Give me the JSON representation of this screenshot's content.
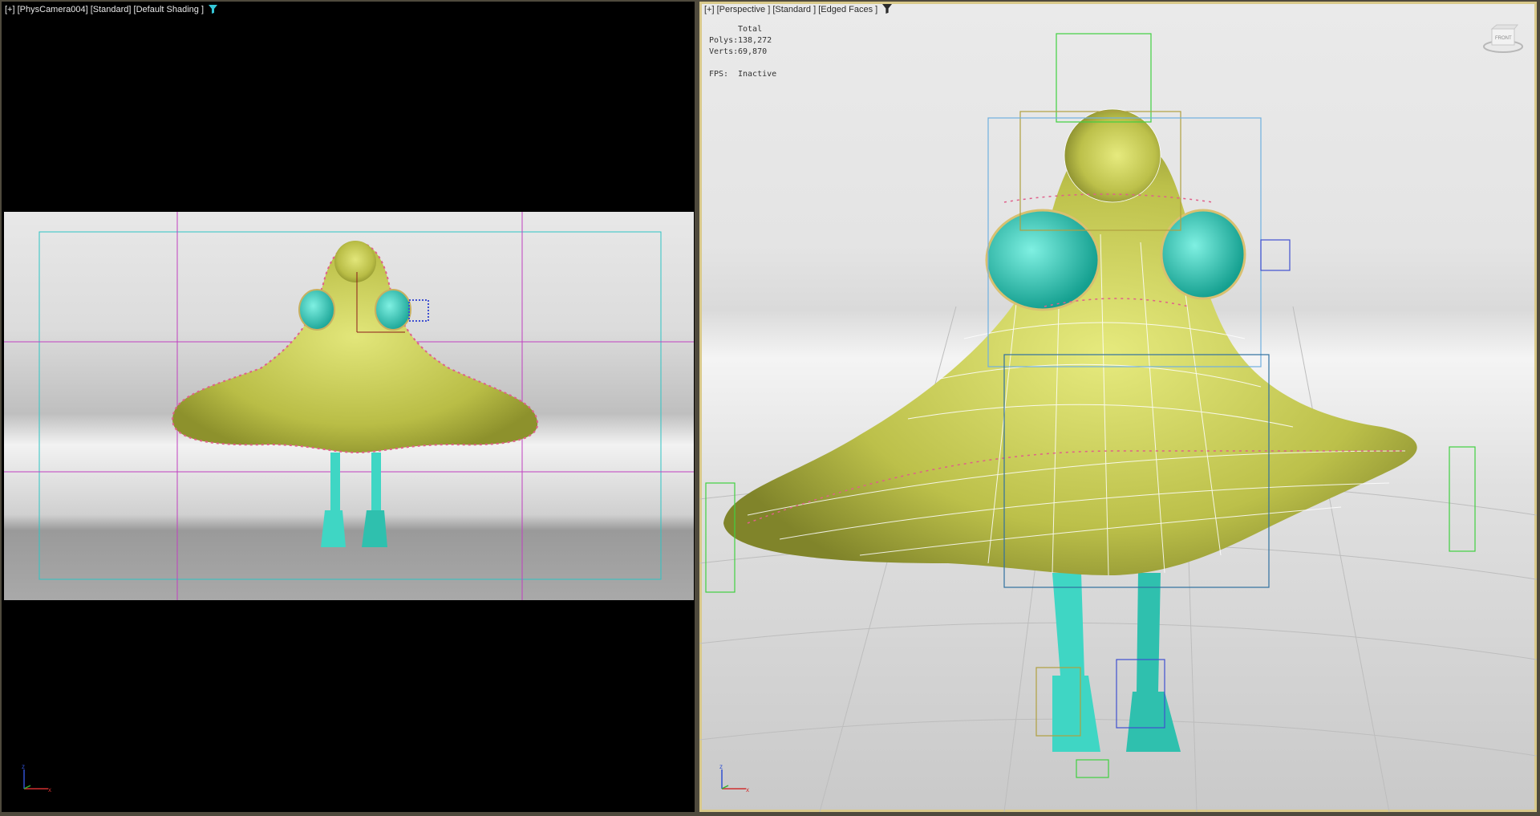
{
  "left_viewport": {
    "label_plus": "[+]",
    "label_camera": "[PhysCamera004]",
    "label_mode": "[Standard]",
    "label_shading": "[Default Shading ]",
    "icons": [
      "filter-icon"
    ]
  },
  "right_viewport": {
    "label_plus": "[+]",
    "label_camera": "[Perspective ]",
    "label_mode": "[Standard ]",
    "label_shading": "[Edged Faces ]",
    "icons": [
      "filter-icon",
      "viewcube-icon"
    ],
    "viewcube_label": "FRONT",
    "stats": {
      "header": "Total",
      "polys_label": "Polys:",
      "polys_value": "138,272",
      "verts_label": "Verts:",
      "verts_value": "69,870",
      "fps_label": "FPS:",
      "fps_value": "Inactive"
    }
  },
  "axis_labels": {
    "x": "x",
    "y": "y",
    "z": "z"
  },
  "colors": {
    "body": "#c8cc5a",
    "feet_eyes": "#3fd6c4",
    "hair": "#e0608a",
    "safe_frame": "#2ec4c4",
    "grid_lines": "#c040c0",
    "active_border": "#d9c98a"
  }
}
